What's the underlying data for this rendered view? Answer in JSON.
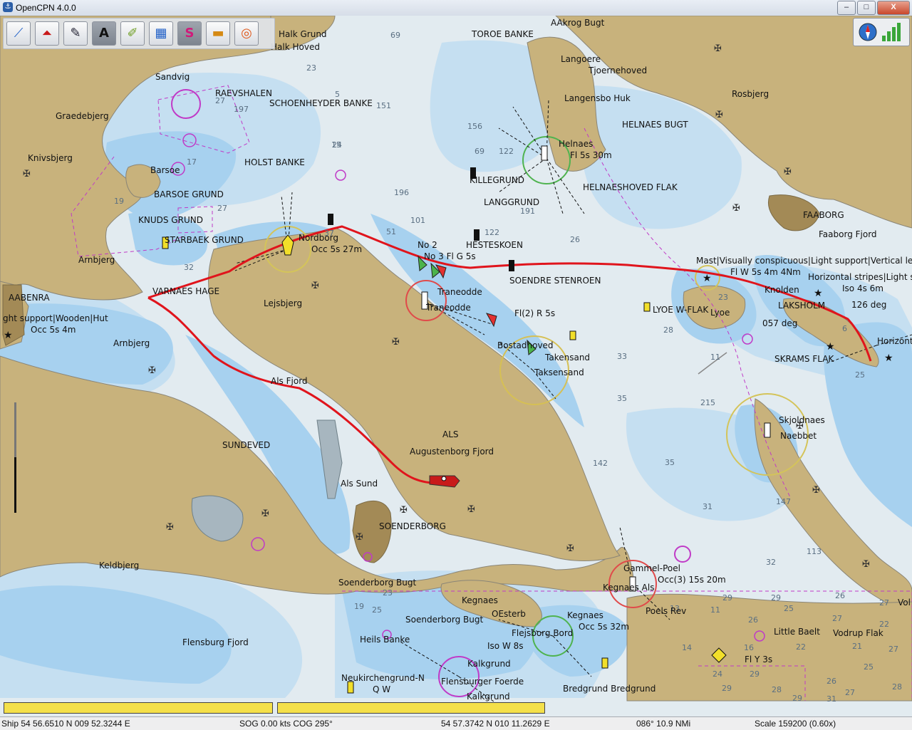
{
  "window": {
    "title": "OpenCPN 4.0.0",
    "min_label": "–",
    "max_label": "□",
    "close_label": "X"
  },
  "toolbar": {
    "tools": [
      {
        "name": "route-manager",
        "icon": "⟋"
      },
      {
        "name": "ais",
        "icon": "⏶"
      },
      {
        "name": "options",
        "icon": "✎"
      },
      {
        "name": "text",
        "icon": "A"
      },
      {
        "name": "route",
        "icon": "✐"
      },
      {
        "name": "settings",
        "icon": "▦"
      },
      {
        "name": "track",
        "icon": "S"
      },
      {
        "name": "day-night",
        "icon": "▬"
      },
      {
        "name": "mob",
        "icon": "◎"
      }
    ]
  },
  "chart_labels": [
    {
      "id": "halk-grund",
      "text": "Halk Grund"
    },
    {
      "id": "halk-hoved",
      "text": "Halk Hoved"
    },
    {
      "id": "toroe-banke",
      "text": "TOROE BANKE"
    },
    {
      "id": "aakrog-bugt",
      "text": "AAkrog Bugt"
    },
    {
      "id": "langoere",
      "text": "Langoere"
    },
    {
      "id": "tjoernehoved",
      "text": "Tjoernehoved"
    },
    {
      "id": "sandvig",
      "text": "Sandvig"
    },
    {
      "id": "raevshalen",
      "text": "RAEVSHALEN"
    },
    {
      "id": "schoenheyder",
      "text": "SCHOENHEYDER BANKE"
    },
    {
      "id": "langensbo",
      "text": "Langensbo Huk"
    },
    {
      "id": "rosbjerg",
      "text": "Rosbjerg"
    },
    {
      "id": "graedebjerg",
      "text": "Graedebjerg"
    },
    {
      "id": "helnaes-bugt",
      "text": "HELNAES BUGT"
    },
    {
      "id": "helnaes",
      "text": "Helnaes"
    },
    {
      "id": "helnaes-light",
      "text": "Fl 5s 30m"
    },
    {
      "id": "knivsbjerg",
      "text": "Knivsbjerg"
    },
    {
      "id": "holst-banke",
      "text": "HOLST BANKE"
    },
    {
      "id": "barsoe",
      "text": "Barsoe"
    },
    {
      "id": "killegrund",
      "text": "KILLEGRUND"
    },
    {
      "id": "helnaeshoved-flak",
      "text": "HELNAESHOVED FLAK"
    },
    {
      "id": "barsoe-grund",
      "text": "BARSOE GRUND"
    },
    {
      "id": "langgrund",
      "text": "LANGGRUND"
    },
    {
      "id": "faaborg",
      "text": "FAABORG"
    },
    {
      "id": "knuds-grund",
      "text": "KNUDS GRUND"
    },
    {
      "id": "starbaek",
      "text": "STARBAEK GRUND"
    },
    {
      "id": "faaborg-fjord",
      "text": "Faaborg Fjord"
    },
    {
      "id": "nordborg",
      "text": "Nordborg"
    },
    {
      "id": "nordborg-light",
      "text": "Occ 5s 27m"
    },
    {
      "id": "hesteskoen",
      "text": "HESTESKOEN"
    },
    {
      "id": "arnbjerg-1",
      "text": "Arnbjerg"
    },
    {
      "id": "no2",
      "text": "No 2"
    },
    {
      "id": "no3",
      "text": "No 3 Fl G 5s"
    },
    {
      "id": "mast",
      "text": "Mast|Visually conspicuous|Light support|Vertical leng"
    },
    {
      "id": "lyoe-light",
      "text": "Fl W 5s 4m 4Nm"
    },
    {
      "id": "horizontal",
      "text": "Horizontal stripes|Light su"
    },
    {
      "id": "soendre",
      "text": "SOENDRE STENROEN"
    },
    {
      "id": "aabenraa",
      "text": "AABENRA"
    },
    {
      "id": "iso4s",
      "text": "Iso 4s 6m"
    },
    {
      "id": "knolden",
      "text": "Knolden"
    },
    {
      "id": "varnaes",
      "text": "VARNAES HAGE"
    },
    {
      "id": "traneodde-1",
      "text": "Traneodde"
    },
    {
      "id": "lejsbjerg",
      "text": "Lejsbjerg"
    },
    {
      "id": "lakseholm",
      "text": "LAKSHOLM"
    },
    {
      "id": "deg126",
      "text": "126 deg"
    },
    {
      "id": "lyoe-w-flak",
      "text": "LYOE W-FLAK"
    },
    {
      "id": "lyoe",
      "text": "Lyoe"
    },
    {
      "id": "traneodde-2",
      "text": "Traneodde"
    },
    {
      "id": "light-support",
      "text": "ght support|Wooden|Hut"
    },
    {
      "id": "fl2r",
      "text": "Fl(2) R 5s"
    },
    {
      "id": "deg057",
      "text": "057 deg"
    },
    {
      "id": "occ5s4m",
      "text": "Occ 5s 4m"
    },
    {
      "id": "horizont",
      "text": "Horizont"
    },
    {
      "id": "arnbjerg-2",
      "text": "Arnbjerg"
    },
    {
      "id": "bostadhoved",
      "text": "Bostadhoved"
    },
    {
      "id": "takensand-1",
      "text": "Takensand"
    },
    {
      "id": "skrams",
      "text": "SKRAMS FLAK"
    },
    {
      "id": "taksensand",
      "text": "Taksensand"
    },
    {
      "id": "als-fjord",
      "text": "Als Fjord"
    },
    {
      "id": "skjoldnaes",
      "text": "Skjoldnaes"
    },
    {
      "id": "naebbet",
      "text": "Naebbet"
    },
    {
      "id": "als",
      "text": "ALS"
    },
    {
      "id": "sundeved",
      "text": "SUNDEVED"
    },
    {
      "id": "augustenborg",
      "text": "Augustenborg Fjord"
    },
    {
      "id": "als-sund",
      "text": "Als Sund"
    },
    {
      "id": "soenderborg",
      "text": "SOENDERBORG"
    },
    {
      "id": "gammel-poel",
      "text": "Gammel-Poel"
    },
    {
      "id": "keldbjerg",
      "text": "Keldbjerg"
    },
    {
      "id": "kegnaes-als",
      "text": "Kegnaes Als"
    },
    {
      "id": "occ3",
      "text": "Occ(3) 15s 20m"
    },
    {
      "id": "soenderborg-bugt",
      "text": "Soenderborg Bugt"
    },
    {
      "id": "poels-rev",
      "text": "Poels Rev"
    },
    {
      "id": "kegnaes",
      "text": "Kegnaes"
    },
    {
      "id": "oesterb",
      "text": "OEsterb"
    },
    {
      "id": "soenderborg-bugt-2",
      "text": "Soenderborg Bugt"
    },
    {
      "id": "kegnaes-2",
      "text": "Kegnaes"
    },
    {
      "id": "occ5s32m",
      "text": "Occ 5s 32m"
    },
    {
      "id": "little-baelt",
      "text": "Little Baelt"
    },
    {
      "id": "vodrup",
      "text": "Vodrup Flak"
    },
    {
      "id": "heils-banke",
      "text": "Heils Banke"
    },
    {
      "id": "flensburg",
      "text": "Flensburg Fjord"
    },
    {
      "id": "flejsborg",
      "text": "Flejsborg Bord"
    },
    {
      "id": "isow8s",
      "text": "Iso W 8s"
    },
    {
      "id": "fly3s",
      "text": "Fl Y 3s"
    },
    {
      "id": "kalkgrund",
      "text": "Kalkgrund"
    },
    {
      "id": "neukirchen",
      "text": "Neukirchengrund-N"
    },
    {
      "id": "qw",
      "text": "Q W"
    },
    {
      "id": "flensburger",
      "text": "Flensburger Foerde"
    },
    {
      "id": "bredgrund",
      "text": "Bredgrund Bredgrund"
    },
    {
      "id": "kalkgrund-2",
      "text": "Kalkgrund"
    },
    {
      "id": "vol",
      "text": "Vol"
    }
  ],
  "soundings": [
    "69",
    "23",
    "5",
    "15",
    "151",
    "27",
    "197",
    "24",
    "156",
    "69",
    "122",
    "17",
    "19",
    "27",
    "196",
    "191",
    "101",
    "51",
    "37",
    "122",
    "26",
    "32",
    "23",
    "25",
    "28",
    "33",
    "11",
    "6",
    "35",
    "215",
    "142",
    "35",
    "31",
    "147",
    "113",
    "32",
    "29",
    "26",
    "25",
    "27",
    "29",
    "26",
    "27",
    "22",
    "22",
    "21",
    "16",
    "14",
    "13",
    "11",
    "19",
    "23",
    "25",
    "26",
    "28",
    "29",
    "25",
    "27",
    "24",
    "29",
    "31",
    "28",
    "27",
    "29"
  ],
  "status": {
    "ship": "Ship 54 56.6510 N   009 52.3244 E",
    "sog": "SOG 0.00 kts  COG 295°",
    "cursor": "54 57.3742 N   010 11.2629 E",
    "bearing": "086°  10.9 NMi",
    "scale": "Scale 159200 (0.60x)",
    "left_char": "\\"
  },
  "progress": [
    {
      "name": "progress-left",
      "fraction": 1.0
    },
    {
      "name": "progress-right",
      "fraction": 1.0
    }
  ],
  "colors": {
    "land": "#c8b27c",
    "shallow": "#a7d1ef",
    "medium": "#c5dff1",
    "deep": "#e2ebf0",
    "route": "#e0141c",
    "town": "#a38a56",
    "purple": "#c03ac7"
  }
}
